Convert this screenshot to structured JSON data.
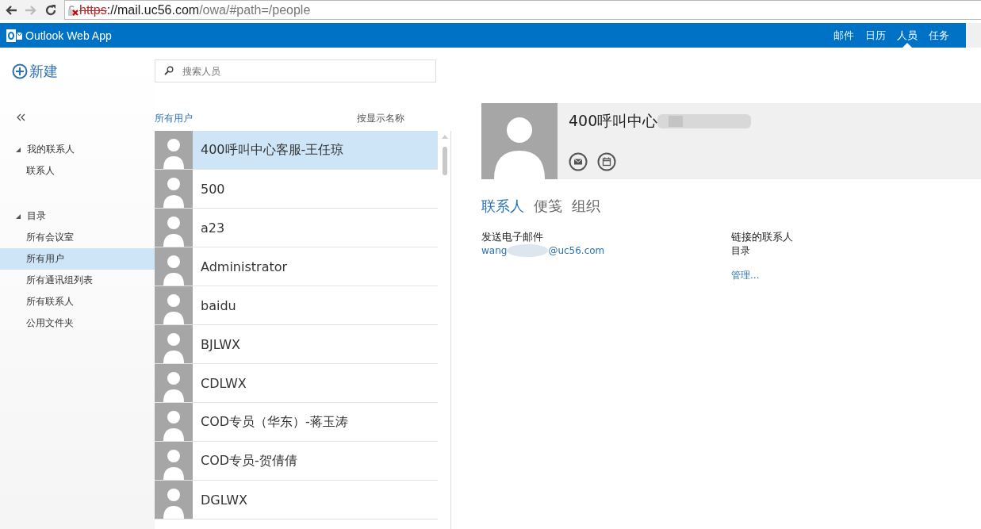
{
  "browser": {
    "url_scheme": "https",
    "url_host": "://mail.uc56.com",
    "url_path": "/owa/#path=/people",
    "insecure": true
  },
  "app_bar": {
    "title": "Outlook Web App",
    "nav": [
      {
        "label": "邮件",
        "selected": false
      },
      {
        "label": "日历",
        "selected": false
      },
      {
        "label": "人员",
        "selected": true
      },
      {
        "label": "任务",
        "selected": false
      }
    ]
  },
  "new_button": "新建",
  "search": {
    "placeholder": "搜索人员"
  },
  "sidebar": {
    "groups": [
      {
        "label": "我的联系人",
        "expanded": true,
        "items": [
          {
            "label": "联系人",
            "selected": false
          }
        ]
      },
      {
        "label": "目录",
        "expanded": true,
        "items": [
          {
            "label": "所有会议室",
            "selected": false
          },
          {
            "label": "所有用户",
            "selected": true
          },
          {
            "label": "所有通讯组列表",
            "selected": false
          },
          {
            "label": "所有联系人",
            "selected": false
          },
          {
            "label": "公用文件夹",
            "selected": false
          }
        ]
      }
    ]
  },
  "list": {
    "title": "所有用户",
    "sort": "按显示名称",
    "rows": [
      {
        "name": "400呼叫中心客服-王任琼",
        "selected": true
      },
      {
        "name": "500",
        "selected": false
      },
      {
        "name": "a23",
        "selected": false
      },
      {
        "name": "Administrator",
        "selected": false
      },
      {
        "name": "baidu",
        "selected": false
      },
      {
        "name": "BJLWX",
        "selected": false
      },
      {
        "name": "CDLWX",
        "selected": false
      },
      {
        "name": "COD专员（华东）-蒋玉涛",
        "selected": false
      },
      {
        "name": "COD专员-贺倩倩",
        "selected": false
      },
      {
        "name": "DGLWX",
        "selected": false
      }
    ]
  },
  "detail": {
    "name": "400呼叫中心",
    "tabs": [
      {
        "label": "联系人",
        "selected": true
      },
      {
        "label": "便笺",
        "selected": false
      },
      {
        "label": "组织",
        "selected": false
      }
    ],
    "email_label": "发送电子邮件",
    "email_start": "wang",
    "email_end": "@uc56.com",
    "linked_label": "链接的联系人",
    "linked_value": "目录",
    "manage": "管理..."
  }
}
